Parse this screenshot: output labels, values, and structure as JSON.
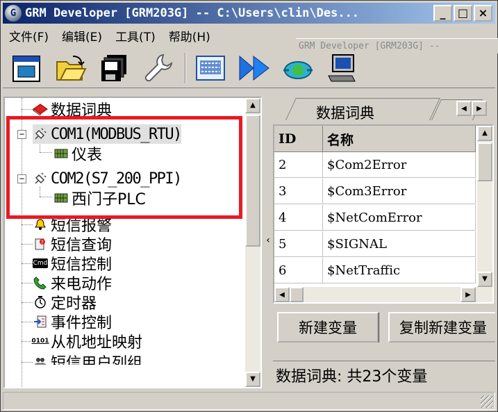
{
  "window": {
    "title": "GRM Developer [GRM203G]  -- C:\\Users\\clin\\Des...",
    "icon_letter": "G",
    "min_glyph": "_",
    "max_glyph": "□",
    "close_glyph": "×"
  },
  "menu": [
    {
      "label": "文件(F)"
    },
    {
      "label": "编辑(E)"
    },
    {
      "label": "工具(T)"
    },
    {
      "label": "帮助(H)"
    }
  ],
  "ghost_title": "GRM Developer [GRM203G]  --",
  "toolbar": [
    {
      "icon": "new-project-icon"
    },
    {
      "icon": "open-folder-icon"
    },
    {
      "icon": "save-icon"
    },
    {
      "icon": "wrench-icon"
    },
    {
      "icon": "keyboard-icon"
    },
    {
      "icon": "fast-forward-icon"
    },
    {
      "icon": "cloud-sync-icon"
    },
    {
      "icon": "computer-icon"
    }
  ],
  "tree": [
    {
      "label": "数据词典",
      "icon": "book-icon"
    },
    {
      "label": "COM1(MODBUS_RTU)",
      "icon": "plug-icon"
    },
    {
      "label": "仪表",
      "icon": "device-icon"
    },
    {
      "label": "COM2(S7_200_PPI)",
      "icon": "plug-icon"
    },
    {
      "label": "西门子PLC",
      "icon": "device-icon"
    },
    {
      "label": "短信报警",
      "icon": "bell-icon"
    },
    {
      "label": "短信查询",
      "icon": "query-icon"
    },
    {
      "label": "短信控制",
      "icon": "cmd-icon",
      "icon_text": "Cmd"
    },
    {
      "label": "来电动作",
      "icon": "phone-icon"
    },
    {
      "label": "定时器",
      "icon": "clock-icon"
    },
    {
      "label": "事件控制",
      "icon": "event-icon"
    },
    {
      "label": "从机地址映射",
      "icon": "binary-icon",
      "icon_text": "0101"
    },
    {
      "label": "短信用户列组",
      "icon": "users-icon"
    }
  ],
  "tabs": {
    "active": "数据词典"
  },
  "table": {
    "columns": [
      "ID",
      "名称"
    ],
    "rows": [
      {
        "id": "2",
        "name": "$Com2Error"
      },
      {
        "id": "3",
        "name": "$Com3Error"
      },
      {
        "id": "4",
        "name": "$NetComError"
      },
      {
        "id": "5",
        "name": "$SIGNAL"
      },
      {
        "id": "6",
        "name": "$NetTraffic"
      }
    ]
  },
  "buttons": {
    "new_var": "新建变量",
    "copy_new": "复制新建变量"
  },
  "status": "数据词典: 共23个变量",
  "colors": {
    "titlebar_start": "#0a246a",
    "titlebar_end": "#a6caf0",
    "highlight_box": "#e81a24",
    "face": "#d4d0c8"
  }
}
